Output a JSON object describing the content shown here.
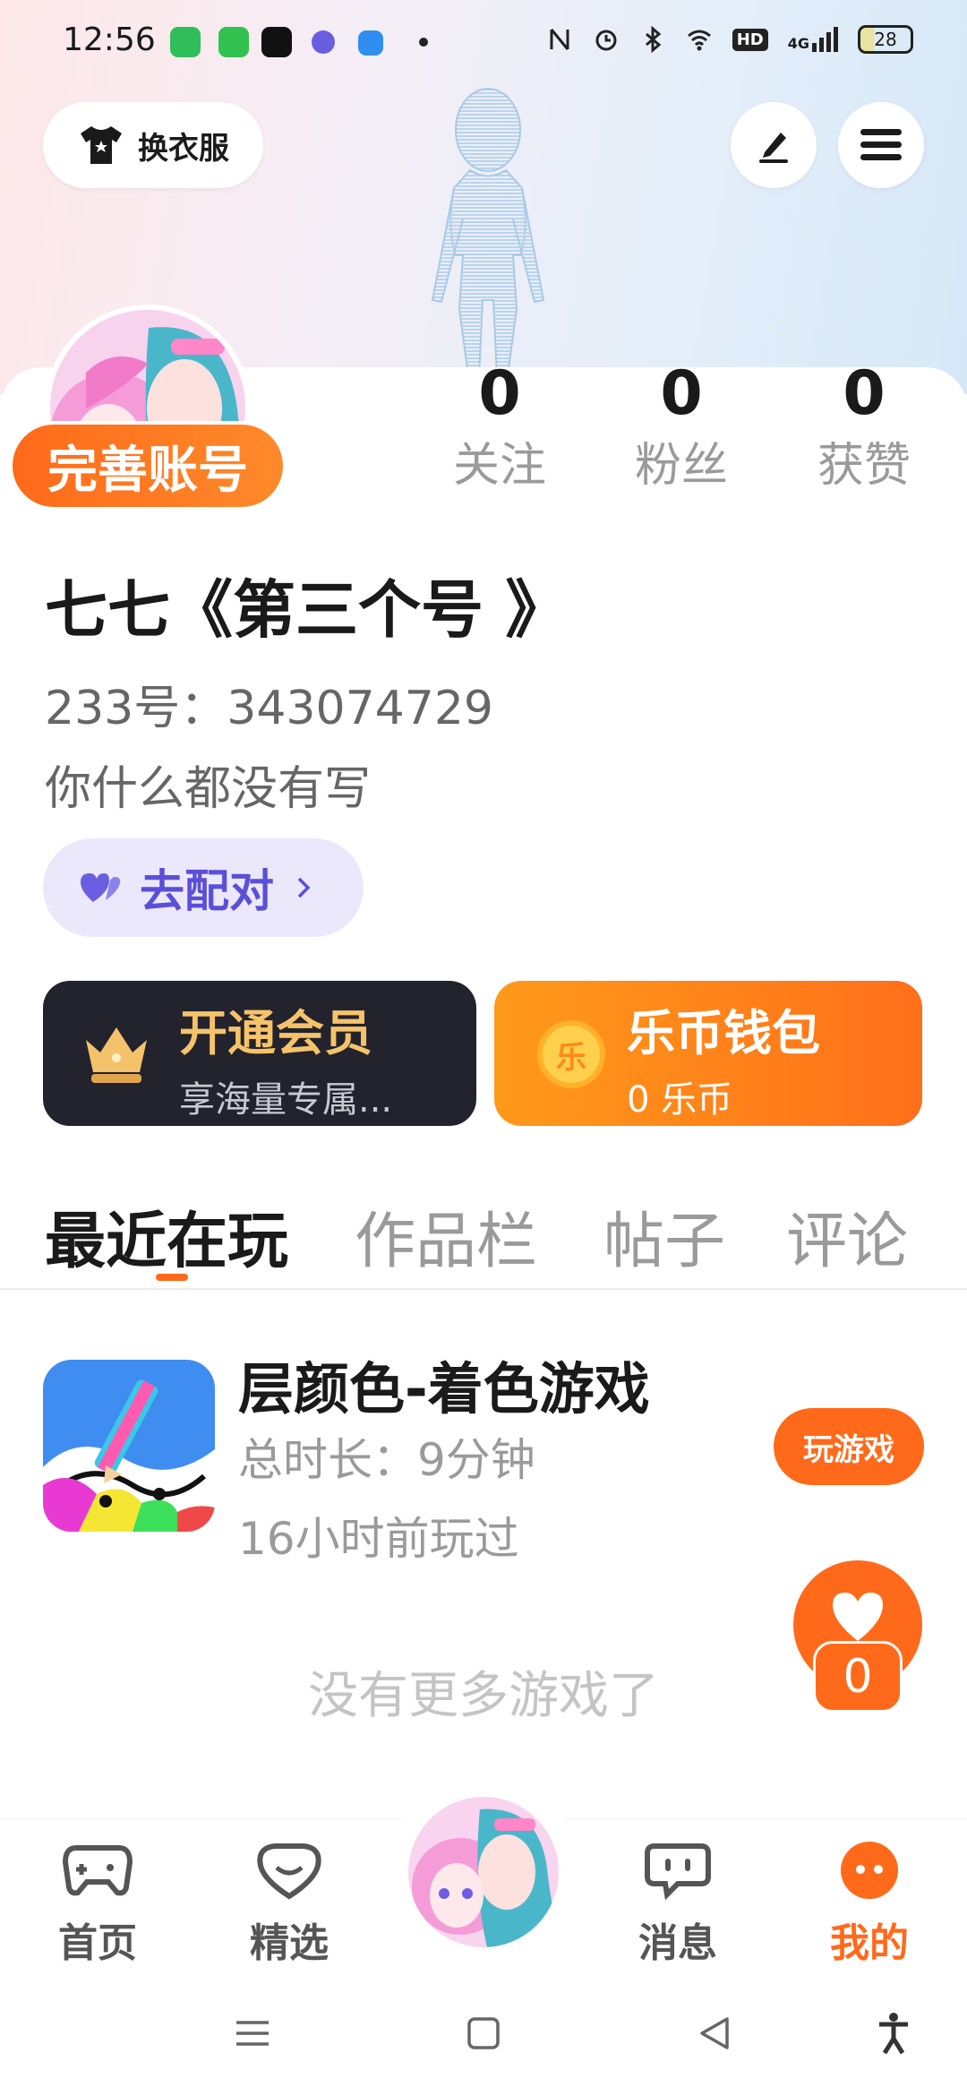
{
  "status_bar": {
    "time": "12:56",
    "network": "4G",
    "hd": "HD",
    "battery": "28"
  },
  "header": {
    "wardrobe_label": "换衣服"
  },
  "profile": {
    "complete_account_label": "完善账号",
    "stats": [
      {
        "value": "0",
        "label": "关注"
      },
      {
        "value": "0",
        "label": "粉丝"
      },
      {
        "value": "0",
        "label": "获赞"
      }
    ],
    "nickname": "七七《第三个号 》",
    "uid": "233号：343074729",
    "bio": "你什么都没有写",
    "match_label": "去配对"
  },
  "cards": {
    "member": {
      "title": "开通会员",
      "subtitle": "享海量专属..."
    },
    "wallet": {
      "title": "乐币钱包",
      "subtitle": "0 乐币",
      "coin_glyph": "乐"
    }
  },
  "tabs": [
    {
      "label": "最近在玩",
      "active": true
    },
    {
      "label": "作品栏",
      "active": false
    },
    {
      "label": "帖子",
      "active": false
    },
    {
      "label": "评论",
      "active": false
    }
  ],
  "games": [
    {
      "title": "层颜色-着色游戏",
      "duration": "总时长：9分钟",
      "last_played": "16小时前玩过",
      "play_label": "玩游戏"
    }
  ],
  "no_more_text": "没有更多游戏了",
  "fab": {
    "count": "0"
  },
  "bottom_nav": [
    {
      "label": "首页",
      "icon": "gamepad-icon",
      "active": false
    },
    {
      "label": "精选",
      "icon": "heart-chat-icon",
      "active": false
    },
    {
      "label": "消息",
      "icon": "message-icon",
      "active": false
    },
    {
      "label": "我的",
      "icon": "profile-face-icon",
      "active": true
    }
  ],
  "colors": {
    "accent": "#ff6a1a",
    "purple": "#5b4fd8",
    "dark_card": "#23232e"
  }
}
